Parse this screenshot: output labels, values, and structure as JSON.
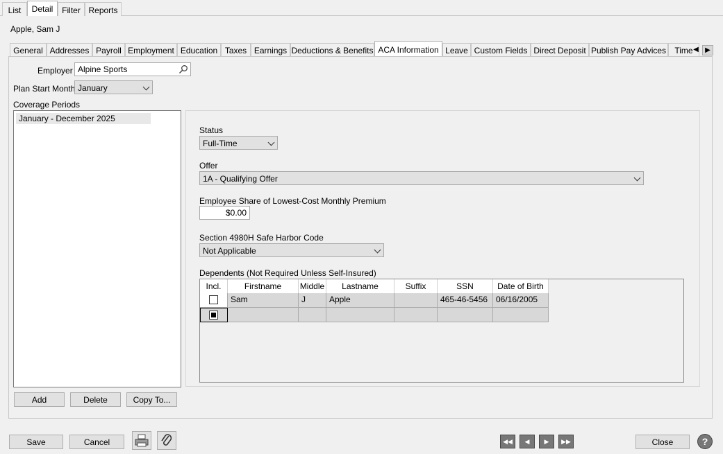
{
  "top_tabs": [
    "List",
    "Detail",
    "Filter",
    "Reports"
  ],
  "employee_name": "Apple, Sam J",
  "sub_tabs": [
    "General",
    "Addresses",
    "Payroll",
    "Employment",
    "Education",
    "Taxes",
    "Earnings",
    "Deductions & Benefits",
    "ACA Information",
    "Leave",
    "Custom Fields",
    "Direct Deposit",
    "Publish Pay Advices",
    "Time"
  ],
  "active_sub_tab": "ACA Information",
  "employer": {
    "label": "Employer",
    "value": "Alpine Sports"
  },
  "plan_start": {
    "label": "Plan Start Month",
    "value": "January"
  },
  "coverage": {
    "label": "Coverage Periods",
    "items": [
      "January - December 2025"
    ]
  },
  "status": {
    "label": "Status",
    "value": "Full-Time"
  },
  "offer": {
    "label": "Offer",
    "value": "1A - Qualifying Offer"
  },
  "premium": {
    "label": "Employee Share of Lowest-Cost Monthly Premium",
    "value": "$0.00"
  },
  "safe_harbor": {
    "label": "Section 4980H Safe Harbor Code",
    "value": "Not Applicable"
  },
  "dependents": {
    "label": "Dependents (Not Required Unless Self-Insured)",
    "columns": [
      "Incl.",
      "Firstname",
      "Middle",
      "Lastname",
      "Suffix",
      "SSN",
      "Date of Birth"
    ],
    "rows": [
      {
        "firstname": "Sam",
        "middle": "J",
        "lastname": "Apple",
        "suffix": "",
        "ssn": "465-46-5456",
        "dob": "06/16/2005"
      }
    ]
  },
  "buttons": {
    "add": "Add",
    "delete": "Delete",
    "copy_to": "Copy To...",
    "save": "Save",
    "cancel": "Cancel",
    "close": "Close"
  },
  "icons": {
    "print": "printer-icon",
    "attach": "paperclip-icon",
    "help": "help-icon"
  }
}
